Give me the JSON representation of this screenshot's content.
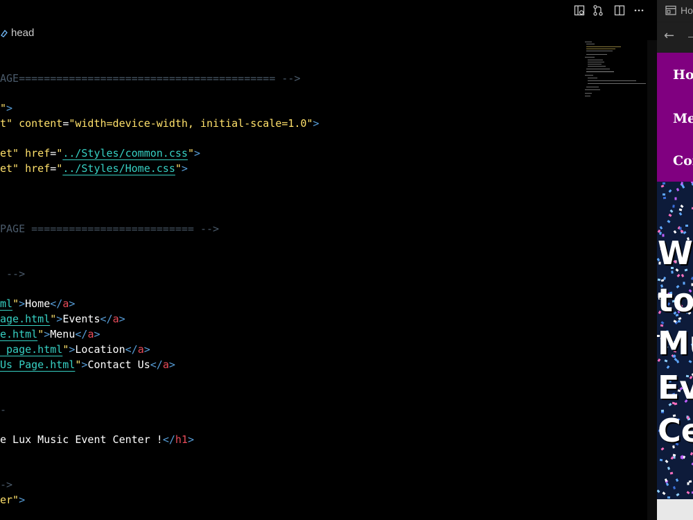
{
  "editor": {
    "breadcrumb": "head",
    "toolbar_icons": [
      "open-preview-icon",
      "source-control-icon",
      "split-editor-icon",
      "more-actions-icon"
    ],
    "lines": {
      "l1": [
        "AGE========================================= -->"
      ],
      "l2_tag": "\">",
      "l3": {
        "a": "t\" ",
        "attr": "content",
        "eq": "=",
        "val": "\"width=device-width, initial-scale=1.0\"",
        "close": ">"
      },
      "l4": {
        "a": "et\" ",
        "attr": "href",
        "eq": "=",
        "q": "\"",
        "val": "../Styles/common.css",
        "q2": "\"",
        "close": ">"
      },
      "l5": {
        "a": "et\" ",
        "attr": "href",
        "eq": "=",
        "q": "\"",
        "val": "../Styles/Home.css",
        "q2": "\"",
        "close": ">"
      },
      "l6": "PAGE ========================== -->",
      "l7": " -->",
      "links": [
        {
          "href": "ml",
          "text": "Home"
        },
        {
          "href": "age.html",
          "text": "Events"
        },
        {
          "href": "e.html",
          "text": "Menu"
        },
        {
          "href": " page.html",
          "text": "Location"
        },
        {
          "href": "Us Page.html",
          "text": "Contact Us"
        }
      ],
      "h1_line": {
        "text": "e Lux Music Event Center !",
        "close": "</h1>"
      },
      "l8": "->",
      "l9": {
        "a": "er\"",
        "close": ">"
      }
    }
  },
  "preview": {
    "tab_label": "Ho",
    "menu": [
      "Home",
      "Menu",
      "Contact"
    ],
    "heading_lines": [
      "Welcome",
      "to",
      "Music",
      "Event",
      "Center"
    ]
  },
  "colors": {
    "menu_bg": "#800080",
    "link": "#37d1c4",
    "tag": "#569cd6",
    "close_tag": "#e84c5a",
    "string": "#ffe16b"
  }
}
